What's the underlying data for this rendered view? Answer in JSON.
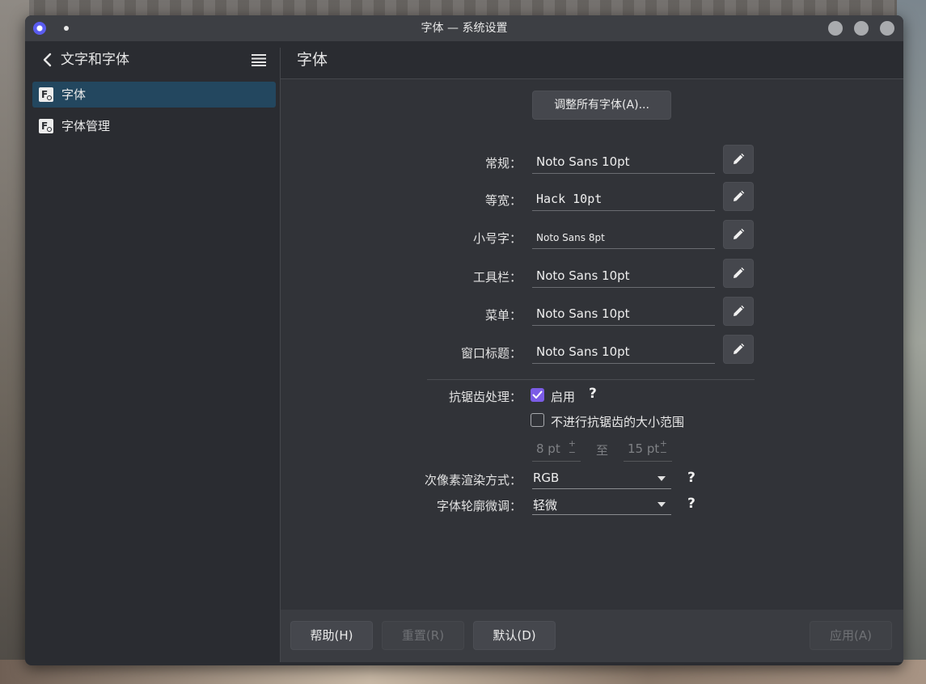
{
  "window": {
    "title": "字体 — 系统设置"
  },
  "sidebar": {
    "header": "文字和字体",
    "items": [
      {
        "label": "字体",
        "active": true
      },
      {
        "label": "字体管理",
        "active": false
      }
    ]
  },
  "main": {
    "title": "字体",
    "adjust_all": "调整所有字体(A)...",
    "fonts": [
      {
        "label": "常规：",
        "value": "Noto Sans 10pt"
      },
      {
        "label": "等宽：",
        "value": "Hack 10pt"
      },
      {
        "label": "小号字：",
        "value": "Noto Sans 8pt"
      },
      {
        "label": "工具栏：",
        "value": "Noto Sans 10pt"
      },
      {
        "label": "菜单：",
        "value": "Noto Sans 10pt"
      },
      {
        "label": "窗口标题：",
        "value": "Noto Sans 10pt"
      }
    ],
    "antialias": {
      "label": "抗锯齿处理：",
      "enable_label": "启用",
      "enabled": true,
      "exclude_label": "不进行抗锯齿的大小范围",
      "exclude_checked": false,
      "from": "8 pt",
      "to_label": "至",
      "to": "15 pt"
    },
    "subpixel": {
      "label": "次像素渲染方式：",
      "value": "RGB"
    },
    "hinting": {
      "label": "字体轮廓微调：",
      "value": "轻微"
    },
    "help_mark": "?"
  },
  "footer": {
    "help": "帮助(H)",
    "reset": "重置(R)",
    "defaults": "默认(D)",
    "apply": "应用(A)"
  },
  "colors": {
    "accent": "#7b5ce6",
    "selection": "#23475f"
  }
}
